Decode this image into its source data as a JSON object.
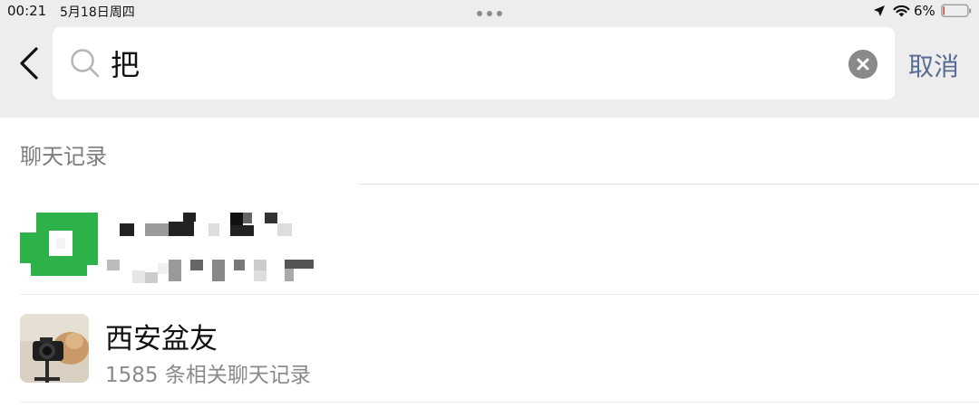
{
  "status_bar": {
    "time": "00:21",
    "date": "5月18日周四",
    "battery_percent": "6%",
    "battery_level": 0.06
  },
  "search": {
    "query": "把",
    "cancel_label": "取消"
  },
  "results": {
    "section_title": "聊天记录",
    "items": [
      {
        "name": "",
        "subtitle": "",
        "obscured": true,
        "avatar": "green-mosaic-avatar"
      },
      {
        "name": "西安盆友",
        "subtitle": "1585 条相关聊天记录",
        "avatar": "camera-photo-avatar"
      }
    ]
  },
  "colors": {
    "bar_background": "#ededed",
    "link_blue": "#576b95",
    "wechat_green": "#2db24a",
    "battery_red": "#e03b2f",
    "secondary_text": "#8a8a8a"
  }
}
